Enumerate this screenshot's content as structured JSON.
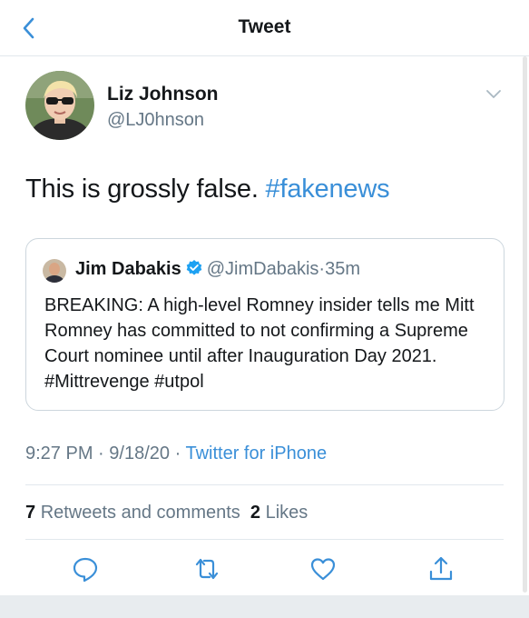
{
  "topbar": {
    "title": "Tweet",
    "back_icon": "chevron-left-icon"
  },
  "author": {
    "name": "Liz Johnson",
    "handle": "@LJ0hnson",
    "more_icon": "chevron-down-icon"
  },
  "tweet": {
    "text": "This is grossly false.",
    "hashtag": "#fakenews"
  },
  "quoted": {
    "name": "Jim Dabakis",
    "verified_icon": "verified-badge-icon",
    "handle": "@JimDabakis",
    "dot": "·",
    "time": "35m",
    "text": "BREAKING: A high-level Romney insider tells me Mitt Romney has committed to not confirming a Supreme Court nominee until after Inauguration Day 2021. #Mittrevenge #utpol"
  },
  "meta": {
    "time": "9:27 PM",
    "dot1": "·",
    "date": "9/18/20",
    "dot2": "·",
    "source": "Twitter for iPhone"
  },
  "stats": {
    "retweets_count": "7",
    "retweets_label": "Retweets and comments",
    "likes_count": "2",
    "likes_label": "Likes"
  },
  "actions": [
    "reply-icon",
    "retweet-icon",
    "like-icon",
    "share-icon"
  ],
  "colors": {
    "accent": "#3a8fd8",
    "muted": "#657786",
    "text": "#14171a",
    "divider": "#e1e8ed"
  }
}
